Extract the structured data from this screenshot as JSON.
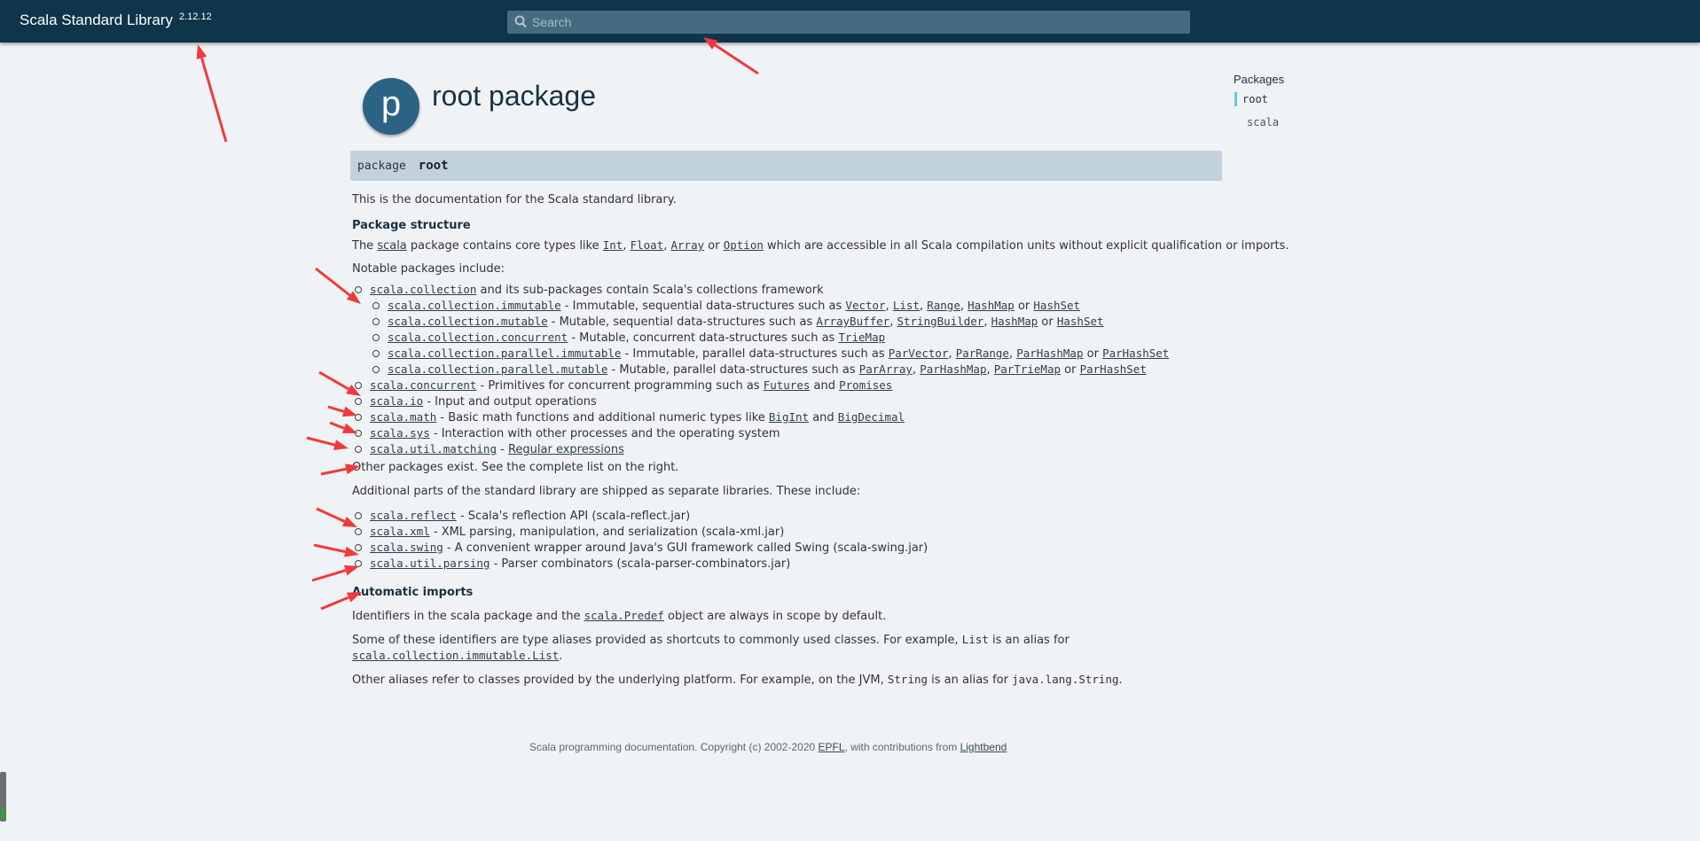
{
  "header": {
    "brand": "Scala Standard Library",
    "version": "2.12.12",
    "search_placeholder": "Search"
  },
  "title": {
    "icon_letter": "p",
    "text": "root package"
  },
  "signature": {
    "keyword": "package",
    "name": "root"
  },
  "doc": {
    "intro": "This is the documentation for the Scala standard library.",
    "h_structure": "Package structure",
    "structure_text": {
      "a": "The ",
      "scala": "scala",
      "b": " package contains core types like ",
      "int": "Int",
      "c": ", ",
      "float": "Float",
      "d": ", ",
      "array": "Array",
      "e": " or ",
      "option": "Option",
      "f": " which are accessible in all Scala compilation units without explicit qualification or imports."
    },
    "notable": "Notable packages include:",
    "packages": [
      {
        "link": "scala.collection",
        "text": " and its sub-packages contain Scala's collections framework"
      },
      {
        "link": "scala.collection.immutable",
        "text": " - Immutable, sequential data-structures such as ",
        "refs": [
          "Vector",
          "List",
          "Range",
          "HashMap",
          "HashSet"
        ],
        "sub": true
      },
      {
        "link": "scala.collection.mutable",
        "text": " - Mutable, sequential data-structures such as ",
        "refs": [
          "ArrayBuffer",
          "StringBuilder",
          "HashMap",
          "HashSet"
        ],
        "sub": true
      },
      {
        "link": "scala.collection.concurrent",
        "text": " - Mutable, concurrent data-structures such as ",
        "refs": [
          "TrieMap"
        ],
        "sub": true
      },
      {
        "link": "scala.collection.parallel.immutable",
        "text": " - Immutable, parallel data-structures such as ",
        "refs": [
          "ParVector",
          "ParRange",
          "ParHashMap",
          "ParHashSet"
        ],
        "sub": true
      },
      {
        "link": "scala.collection.parallel.mutable",
        "text": " - Mutable, parallel data-structures such as ",
        "refs": [
          "ParArray",
          "ParHashMap",
          "ParTrieMap",
          "ParHashSet"
        ],
        "sub": true
      },
      {
        "link": "scala.concurrent",
        "text": " - Primitives for concurrent programming such as ",
        "refs": [
          "Futures",
          "Promises"
        ]
      },
      {
        "link": "scala.io",
        "text": " - Input and output operations"
      },
      {
        "link": "scala.math",
        "text": " - Basic math functions and additional numeric types like ",
        "refs": [
          "BigInt",
          "BigDecimal"
        ]
      },
      {
        "link": "scala.sys",
        "text": " - Interaction with other processes and the operating system"
      },
      {
        "link": "scala.util.matching",
        "text": " - ",
        "refs": [
          "Regular expressions"
        ]
      }
    ],
    "other_exist": "Other packages exist. See the complete list on the right.",
    "additional": "Additional parts of the standard library are shipped as separate libraries. These include:",
    "libs": [
      {
        "link": "scala.reflect",
        "text": " - Scala's reflection API (scala-reflect.jar)"
      },
      {
        "link": "scala.xml",
        "text": " - XML parsing, manipulation, and serialization (scala-xml.jar)"
      },
      {
        "link": "scala.swing",
        "text": " - A convenient wrapper around Java's GUI framework called Swing (scala-swing.jar)"
      },
      {
        "link": "scala.util.parsing",
        "text": " - Parser combinators (scala-parser-combinators.jar)"
      }
    ],
    "h_imports": "Automatic imports",
    "imports_1a": "Identifiers in the scala package and the ",
    "imports_1_link": "scala.Predef",
    "imports_1b": " object are always in scope by default.",
    "imports_2a": "Some of these identifiers are type aliases provided as shortcuts to commonly used classes. For example, ",
    "imports_2_code": "List",
    "imports_2b": " is an alias for",
    "imports_2_link": "scala.collection.immutable.List",
    "imports_2c": ".",
    "imports_3a": "Other aliases refer to classes provided by the underlying platform. For example, on the JVM, ",
    "imports_3_code1": "String",
    "imports_3b": " is an alias for ",
    "imports_3_code2": "java.lang.String",
    "imports_3c": "."
  },
  "right_nav": {
    "title": "Packages",
    "items": [
      "root",
      "scala"
    ]
  },
  "footer": {
    "a": "Scala programming documentation. Copyright (c) 2002-2020 ",
    "epfl": "EPFL",
    "b": ", with contributions from ",
    "lightbend": "Lightbend"
  },
  "colors": {
    "header_bg": "#0e3549",
    "search_bg": "#456b80",
    "package_circle": "#2c6284",
    "signature_bg": "#c2d2dc",
    "nav_accent": "#5ccbe2",
    "annotation_arrow": "#f03a3a"
  }
}
